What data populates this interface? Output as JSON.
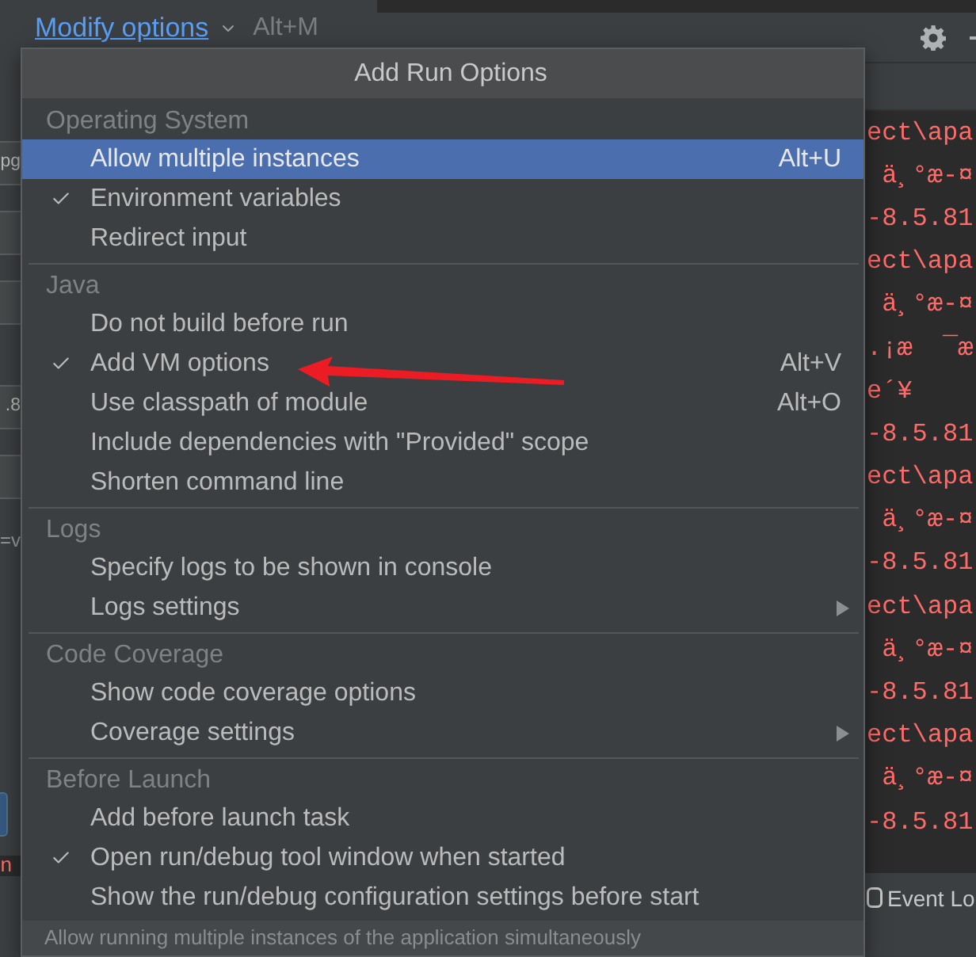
{
  "top_bar": {
    "link": "Modify options",
    "shortcut": "Alt+M"
  },
  "left_panel": {
    "fragments": [
      {
        "kind": "field",
        "text": "pg"
      },
      {
        "kind": "field"
      },
      {
        "kind": "field"
      },
      {
        "kind": "field",
        "text": ".8"
      },
      {
        "kind": "field"
      },
      {
        "kind": "text",
        "text": "=v"
      },
      {
        "kind": "button"
      },
      {
        "kind": "error",
        "text": "n"
      }
    ]
  },
  "console": {
    "lines": [
      "ect\\apa",
      " ä¸°æ-¤",
      "-8.5.81",
      "ect\\apa",
      " ä¸°æ-¤",
      ".¡æ  ¯æ",
      "e´¥",
      "-8.5.81",
      "ect\\apa",
      " ä¸°æ-¤",
      "-8.5.81",
      "ect\\apa",
      " ä¸°æ-¤",
      "-8.5.81",
      "ect\\apa",
      " ä¸°æ-¤",
      "-8.5.81"
    ]
  },
  "status_bar": {
    "event_log": "Event Lo"
  },
  "menu": {
    "title": "Add Run Options",
    "sections": [
      {
        "header": "Operating System",
        "items": [
          {
            "label": "Allow multiple instances",
            "shortcut": "Alt+U",
            "checked": false,
            "selected": true,
            "submenu": false
          },
          {
            "label": "Environment variables",
            "checked": true,
            "selected": false,
            "submenu": false
          },
          {
            "label": "Redirect input",
            "checked": false,
            "selected": false,
            "submenu": false
          }
        ]
      },
      {
        "header": "Java",
        "items": [
          {
            "label": "Do not build before run",
            "checked": false,
            "selected": false,
            "submenu": false
          },
          {
            "label": "Add VM options",
            "shortcut": "Alt+V",
            "checked": true,
            "selected": false,
            "submenu": false
          },
          {
            "label": "Use classpath of module",
            "shortcut": "Alt+O",
            "checked": false,
            "selected": false,
            "submenu": false
          },
          {
            "label": "Include dependencies with \"Provided\" scope",
            "checked": false,
            "selected": false,
            "submenu": false
          },
          {
            "label": "Shorten command line",
            "checked": false,
            "selected": false,
            "submenu": false
          }
        ]
      },
      {
        "header": "Logs",
        "items": [
          {
            "label": "Specify logs to be shown in console",
            "checked": false,
            "selected": false,
            "submenu": false
          },
          {
            "label": "Logs settings",
            "checked": false,
            "selected": false,
            "submenu": true
          }
        ]
      },
      {
        "header": "Code Coverage",
        "items": [
          {
            "label": "Show code coverage options",
            "checked": false,
            "selected": false,
            "submenu": false
          },
          {
            "label": "Coverage settings",
            "checked": false,
            "selected": false,
            "submenu": true
          }
        ]
      },
      {
        "header": "Before Launch",
        "items": [
          {
            "label": "Add before launch task",
            "checked": false,
            "selected": false,
            "submenu": false
          },
          {
            "label": "Open run/debug tool window when started",
            "checked": true,
            "selected": false,
            "submenu": false
          },
          {
            "label": "Show the run/debug configuration settings before start",
            "checked": false,
            "selected": false,
            "submenu": false
          }
        ]
      }
    ],
    "footer": "Allow running multiple instances of the application simultaneously"
  }
}
